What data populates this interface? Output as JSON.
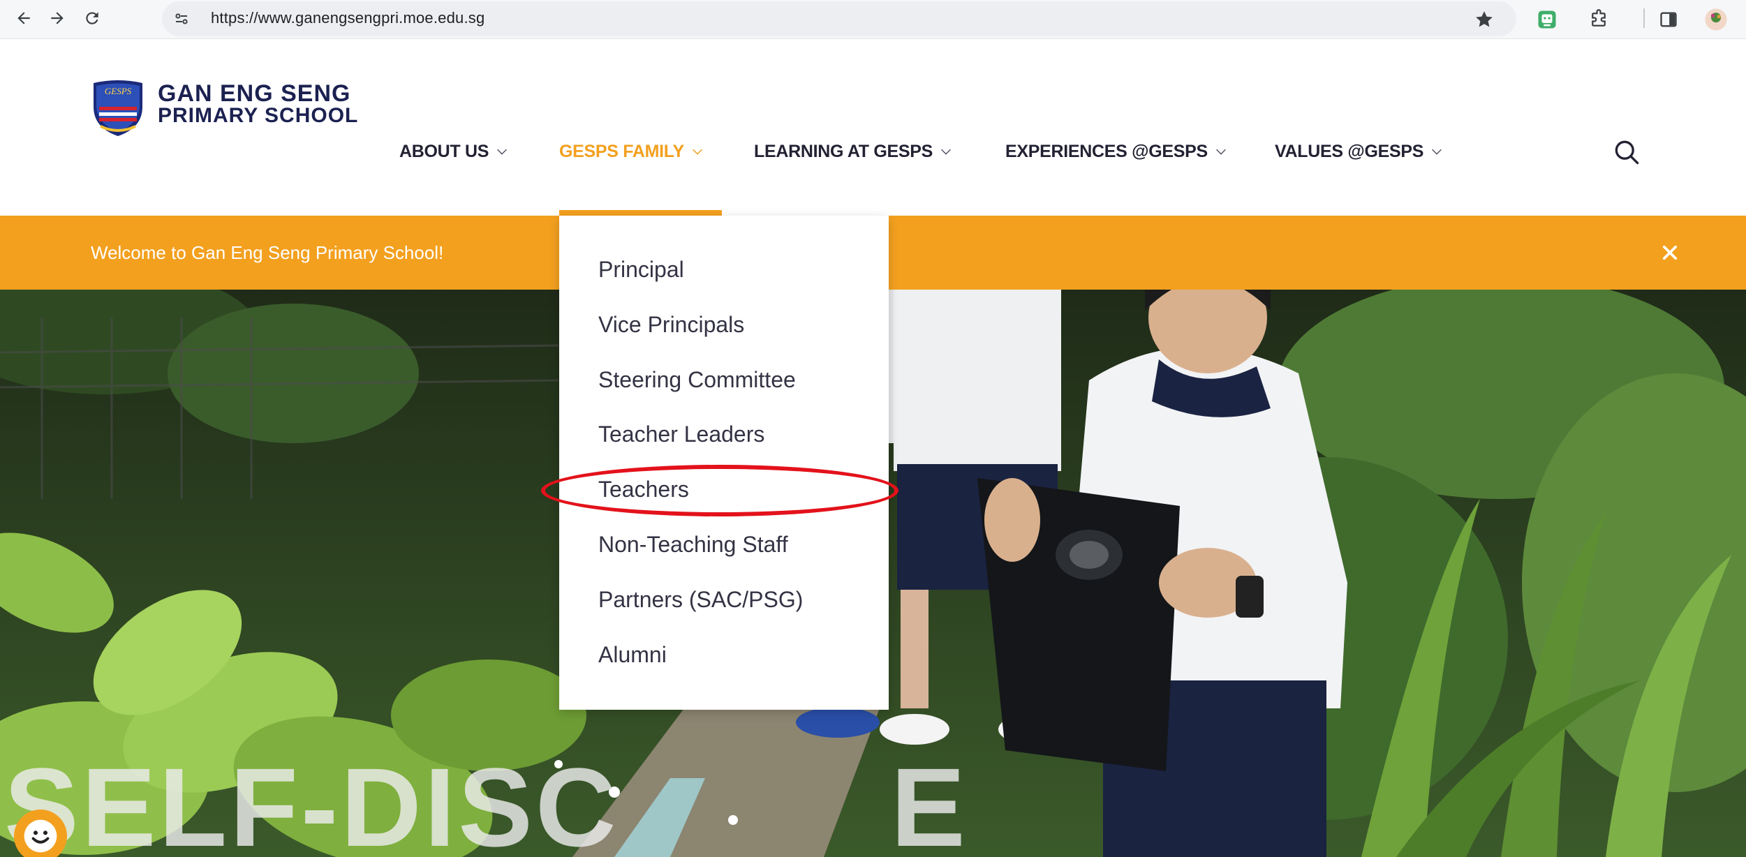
{
  "browser": {
    "url": "https://www.ganengsengpri.moe.edu.sg",
    "back_icon": "arrow-left-icon",
    "forward_icon": "arrow-right-icon",
    "reload_icon": "reload-icon",
    "site_info_icon": "tune-icon",
    "bookmark_icon": "star-icon",
    "extension_icon": "puzzle-icon",
    "sidepanel_icon": "side-panel-icon",
    "profile_icon": "avatar-icon"
  },
  "school": {
    "name_line1": "GAN ENG SENG",
    "name_line2": "PRIMARY SCHOOL",
    "crest_text": "GESPS"
  },
  "nav": {
    "items": [
      {
        "label": "ABOUT US"
      },
      {
        "label": "GESPS FAMILY",
        "active": true
      },
      {
        "label": "LEARNING AT GESPS"
      },
      {
        "label": "EXPERIENCES @GESPS"
      },
      {
        "label": "VALUES @GESPS"
      }
    ],
    "search_icon": "search-icon"
  },
  "banner": {
    "text": "Welcome to Gan Eng Seng Primary School!",
    "close_icon": "close-icon"
  },
  "dropdown": {
    "items": [
      {
        "label": "Principal"
      },
      {
        "label": "Vice Principals"
      },
      {
        "label": "Steering Committee"
      },
      {
        "label": "Teacher Leaders"
      },
      {
        "label": "Teachers",
        "highlighted": true
      },
      {
        "label": "Non-Teaching Staff"
      },
      {
        "label": "Partners (SAC/PSG)"
      },
      {
        "label": "Alumni"
      }
    ]
  },
  "hero": {
    "title_visible": "SELF-DISC",
    "title_tail": "E"
  },
  "colors": {
    "accent": "#f3a01f",
    "navy": "#1b2150",
    "highlight": "#e3121b"
  }
}
